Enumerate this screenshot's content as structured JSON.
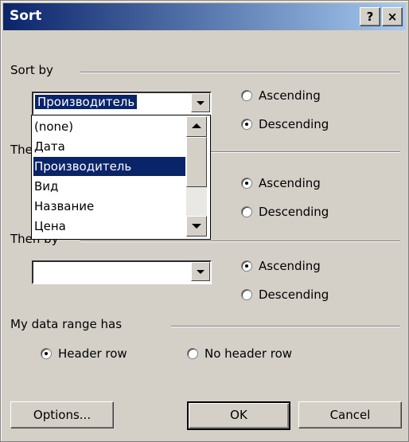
{
  "window": {
    "title": "Sort",
    "help_label": "?",
    "close_label": "×"
  },
  "sort_by": {
    "label": "Sort by",
    "selected": "Производитель",
    "ascending_label": "Ascending",
    "descending_label": "Descending",
    "order": "descending"
  },
  "dropdown_list": {
    "items": [
      "(none)",
      "Дата",
      "Производитель",
      "Вид",
      "Название",
      "Цена"
    ],
    "selected_index": 2
  },
  "then_by_1": {
    "label": "Then by",
    "selected": "",
    "ascending_label": "Ascending",
    "descending_label": "Descending",
    "order": "ascending"
  },
  "then_by_2": {
    "label": "Then by",
    "selected": "",
    "ascending_label": "Ascending",
    "descending_label": "Descending",
    "order": "ascending"
  },
  "data_range": {
    "label": "My data range has",
    "header_row_label": "Header row",
    "no_header_row_label": "No header row",
    "selected": "header"
  },
  "buttons": {
    "options": "Options...",
    "ok": "OK",
    "cancel": "Cancel"
  },
  "colors": {
    "title_start": "#0a246a",
    "title_end": "#a6caf0",
    "face": "#d4d0c8",
    "highlight": "#0a246a"
  }
}
